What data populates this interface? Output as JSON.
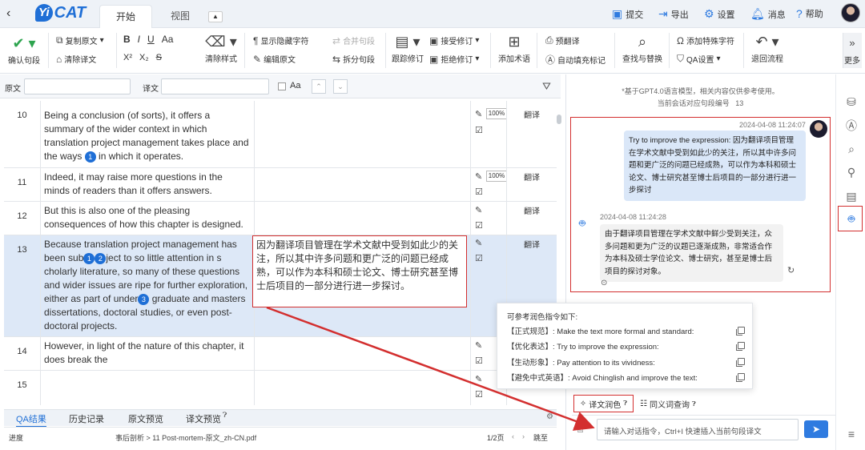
{
  "topbar": {
    "logo_badge": "Yi",
    "logo_text": "CAT",
    "tabs": [
      "开始",
      "视图"
    ],
    "actions": {
      "submit": "提交",
      "export": "导出",
      "settings": "设置",
      "messages": "消息",
      "help": "帮助"
    }
  },
  "ribbon": {
    "confirm": "确认句段",
    "copy_source": "复制原文",
    "clear_target": "清除译文",
    "clear_format": "清除样式",
    "show_hidden": "显示隐藏字符",
    "edit_source": "编辑原文",
    "merge": "合并句段",
    "split": "拆分句段",
    "track_changes": "跟踪修订",
    "accept": "接受修订",
    "reject": "拒绝修订",
    "add_term": "添加术语",
    "pretranslate": "预翻译",
    "autofill": "自动填充标记",
    "find_replace": "查找与替换",
    "add_special": "添加特殊字符",
    "qa_settings": "QA设置",
    "back_flow": "退回流程",
    "more": "更多",
    "format_bold": "B",
    "format_italic": "I",
    "format_underline": "U",
    "format_case": "Aa",
    "superscript": "X²",
    "subscript": "X₂",
    "strike": "S"
  },
  "filter": {
    "source_label": "原文",
    "target_label": "译文",
    "case_label": "Aa"
  },
  "rows": [
    {
      "num": "10",
      "src_parts": [
        "Being a conclusion (of sorts), it offers a summary of the wider context in which translation project management takes place and the ways ",
        "1",
        " in which it operates."
      ],
      "target": "",
      "percent": "100%",
      "status": "翻译"
    },
    {
      "num": "11",
      "src": "Indeed, it may raise more questions in the minds of readers than it offers answers.",
      "target": "",
      "percent": "100%",
      "status": "翻译"
    },
    {
      "num": "12",
      "src": "But this is also one of the pleasing consequences of how this chapter is designed.",
      "target": "",
      "status": "翻译"
    },
    {
      "num": "13",
      "src_a": "Because translation project management has been sub",
      "tag1": "1",
      "tag2": "2",
      "src_b": "ject to so little attention in s cholarly literature, so many of these questions and wider issues are ripe for further exploration, either as part of under",
      "tag3": "3",
      "src_c": " graduate and masters dissertations, doctoral studies, or even post-doctoral projects.",
      "target": "因为翻译项目管理在学术文献中受到如此少的关注，所以其中许多问题和更广泛的问题已经成熟，可以作为本科和硕士论文、博士研究甚至博士后项目的一部分进行进一步探讨。",
      "status": "翻译"
    },
    {
      "num": "14",
      "src": "However, in light of the nature of this chapter, it does break the",
      "target": "",
      "status": "翻译"
    },
    {
      "num": "15",
      "src": "",
      "target": "",
      "status": ""
    }
  ],
  "bottom_tabs": [
    "QA结果",
    "历史记录",
    "原文预览",
    "译文预览"
  ],
  "status_bar": {
    "progress_label": "进度",
    "file_path": "事后剖析 > 11 Post-mortem-原文_zh-CN.pdf",
    "page": "1/2页",
    "goto": "跳至"
  },
  "chat": {
    "disclaimer_1": "*基于GPT4.0语言模型，相关内容仅供参考使用。",
    "disclaimer_2": "当前会话对应句段编号",
    "segment_no": "13",
    "user_time": "2024-04-08 11:24:07",
    "user_msg": "Try to improve the expression: 因为翻译项目管理在学术文献中受到如此少的关注，所以其中许多问题和更广泛的问题已经成熟，可以作为本科和硕士论文、博士研究甚至博士后项目的一部分进行进一步探讨",
    "bot_time": "2024-04-08 11:24:28",
    "bot_msg": "由于翻译项目管理在学术文献中鲜少受到关注，众多问题和更为广泛的议题已逐渐成熟，非常适合作为本科及硕士学位论文、博士研究，甚至是博士后项目的探讨对象。",
    "popup_title": "可参考润色指令如下:",
    "commands": [
      "【正式规范】: Make the text more formal and standard:",
      "【优化表达】: Try to improve the expression:",
      "【生动形象】: Pay attention to its vividness:",
      "【避免中式英语】: Avoid Chinglish and improve the text:"
    ],
    "polish_label": "译文润色",
    "synonym_label": "同义词查询",
    "input_placeholder": "请输入对话指令，Ctrl+I 快速插入当前句段译文"
  },
  "colors": {
    "accent": "#2f7be0",
    "highlight": "#d32f2f",
    "selected_row": "#dde8f7"
  }
}
